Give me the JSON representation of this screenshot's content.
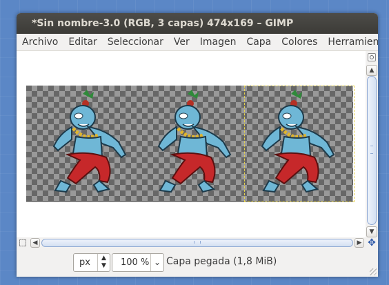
{
  "window": {
    "title": "*Sin nombre-3.0 (RGB, 3 capas) 474x169 – GIMP"
  },
  "menu": {
    "items": [
      "Archivo",
      "Editar",
      "Seleccionar",
      "Ver",
      "Imagen",
      "Capa",
      "Colores",
      "Herramientas"
    ]
  },
  "image": {
    "width": 474,
    "height": 169,
    "layers": 3,
    "figure_count": 3,
    "icon": "genie-character-illustration"
  },
  "scrollbars": {
    "vertical_grip_icon": "grip-lines",
    "horizontal_grip_icon": "grip-lines",
    "scroll_up_icon": "chevron-up",
    "scroll_down_icon": "chevron-down",
    "scroll_left_icon": "chevron-left",
    "scroll_right_icon": "chevron-right"
  },
  "status": {
    "unit": "px",
    "zoom": "100 %",
    "message": "Capa pegada (1,8 MiB)"
  },
  "colors": {
    "desktop": "#5b87c6",
    "titlebar": "#3c3b37",
    "selection_border": "#e8d44d",
    "scroll_accent": "#8fa9d4"
  }
}
